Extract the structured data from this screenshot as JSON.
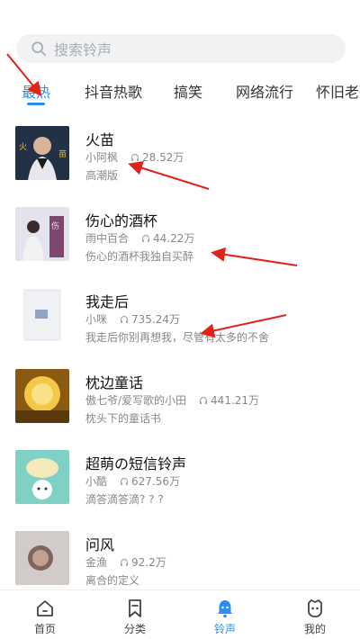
{
  "search": {
    "placeholder": "搜索铃声"
  },
  "tabs": [
    {
      "label": "最热",
      "active": true
    },
    {
      "label": "抖音热歌"
    },
    {
      "label": "搞笑"
    },
    {
      "label": "网络流行"
    },
    {
      "label": "怀旧老歌"
    }
  ],
  "songs": [
    {
      "title": "火苗",
      "artist": "小阿枫",
      "plays": "28.52万",
      "desc": "高潮版",
      "cover_colors": [
        "#1d2b3f",
        "#4a5a70"
      ]
    },
    {
      "title": "伤心的酒杯",
      "artist": "雨中百合",
      "plays": "44.22万",
      "desc": "伤心的酒杯我独自买醉",
      "cover_colors": [
        "#d9d9e6",
        "#6b2d5a"
      ]
    },
    {
      "title": "我走后",
      "artist": "小咪",
      "plays": "735.24万",
      "desc": "我走后你别再想我，尽管有太多的不舍",
      "cover_colors": [
        "#f4f4f6",
        "#c8cdd6"
      ]
    },
    {
      "title": "枕边童话",
      "artist": "傲七爷/爱写歌的小田",
      "plays": "441.21万",
      "desc": "枕头下的童话书",
      "cover_colors": [
        "#f3c845",
        "#8a5a12"
      ]
    },
    {
      "title": "超萌の短信铃声",
      "artist": "小酷",
      "plays": "627.56万",
      "desc": "滴答滴答滴? ? ?",
      "cover_colors": [
        "#7fd1c5",
        "#f4e9b8"
      ]
    },
    {
      "title": "问风",
      "artist": "金渔",
      "plays": "92.2万",
      "desc": "离合的定义",
      "cover_colors": [
        "#c9c4c0",
        "#6b4a40"
      ]
    }
  ],
  "tabbar": [
    {
      "label": "首页",
      "icon": "home-icon"
    },
    {
      "label": "分类",
      "icon": "bookmark-icon"
    },
    {
      "label": "铃声",
      "icon": "bell-icon",
      "active": true
    },
    {
      "label": "我的",
      "icon": "face-icon"
    }
  ],
  "colors": {
    "accent": "#2b8ff0",
    "annotation": "#e0221b"
  }
}
